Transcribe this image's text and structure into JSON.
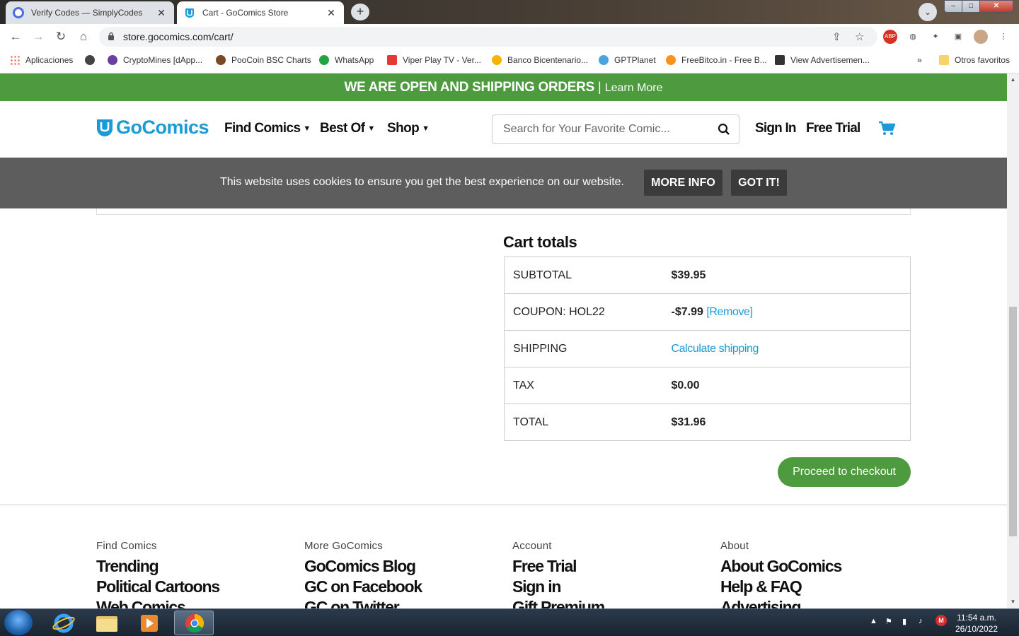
{
  "browser": {
    "tabs": [
      {
        "title": "Verify Codes — SimplyCodes",
        "active": false
      },
      {
        "title": "Cart - GoComics Store",
        "active": true
      }
    ],
    "url": "store.gocomics.com/cart/",
    "bookmarks": [
      "Aplicaciones",
      "CryptoMines [dApp...",
      "PooCoin BSC Charts",
      "WhatsApp",
      "Viper Play TV - Ver...",
      "Banco Bicentenario...",
      "GPTPlanet",
      "FreeBitco.in - Free B...",
      "View Advertisemen...",
      "Otros favoritos"
    ],
    "overflow": "»"
  },
  "banner": {
    "bold": "WE ARE OPEN AND SHIPPING ORDERS",
    "sep": "|",
    "link": "Learn More"
  },
  "header": {
    "logo": "GoComics",
    "nav": [
      "Find Comics",
      "Best Of",
      "Shop"
    ],
    "search_placeholder": "Search for Your Favorite Comic...",
    "sign_in": "Sign In",
    "free_trial": "Free Trial"
  },
  "cookie": {
    "message": "This website uses cookies to ensure you get the best experience on our website.",
    "more_info": "MORE INFO",
    "got_it": "GOT IT!"
  },
  "cart_totals": {
    "title": "Cart totals",
    "subtotal_label": "SUBTOTAL",
    "subtotal_value": "$39.95",
    "coupon_label": "COUPON: HOL22",
    "coupon_value": "-$7.99",
    "coupon_remove": "[Remove]",
    "shipping_label": "SHIPPING",
    "shipping_value": "Calculate shipping",
    "tax_label": "TAX",
    "tax_value": "$0.00",
    "total_label": "TOTAL",
    "total_value": "$31.96",
    "checkout_button": "Proceed to checkout"
  },
  "footer": {
    "columns": [
      {
        "heading": "Find Comics",
        "links": [
          "Trending",
          "Political Cartoons",
          "Web Comics"
        ]
      },
      {
        "heading": "More GoComics",
        "links": [
          "GoComics Blog",
          "GC on Facebook",
          "GC on Twitter"
        ]
      },
      {
        "heading": "Account",
        "links": [
          "Free Trial",
          "Sign in",
          "Gift Premium"
        ]
      },
      {
        "heading": "About",
        "links": [
          "About GoComics",
          "Help & FAQ",
          "Advertising"
        ]
      }
    ]
  },
  "taskbar": {
    "time": "11:54 a.m.",
    "date": "26/10/2022"
  },
  "colors": {
    "brand_green": "#4e9a3e",
    "brand_blue": "#1a9bd7",
    "cookie_bg": "#5d5d5d"
  }
}
